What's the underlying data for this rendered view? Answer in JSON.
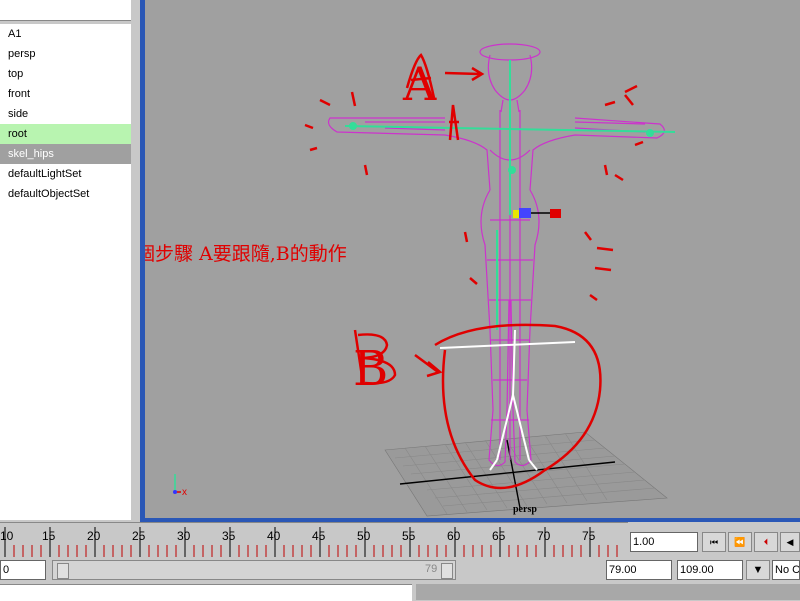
{
  "outliner": {
    "items": [
      {
        "label": "A1",
        "state": "normal"
      },
      {
        "label": "persp",
        "state": "normal"
      },
      {
        "label": "top",
        "state": "normal"
      },
      {
        "label": "front",
        "state": "normal"
      },
      {
        "label": "side",
        "state": "normal"
      },
      {
        "label": "root",
        "state": "selected"
      },
      {
        "label": "skel_hips",
        "state": "dimmed"
      },
      {
        "label": "defaultLightSet",
        "state": "normal"
      },
      {
        "label": "defaultObjectSet",
        "state": "normal"
      }
    ]
  },
  "viewport": {
    "camera_label": "persp",
    "axis_x_label": "x",
    "annotation_a": "A",
    "annotation_b": "B",
    "annotation_note": "下一個步驟 A要跟隨,B的動作",
    "colors": {
      "background": "#a0a0a0",
      "frame": "#2a57b6",
      "mesh": "#cc33cc",
      "joints": "#33dd99",
      "annotation": "#e00000",
      "skeleton_b": "#ffffff"
    }
  },
  "timeline": {
    "ticks": [
      "10",
      "15",
      "20",
      "25",
      "30",
      "35",
      "40",
      "45",
      "50",
      "55",
      "60",
      "65",
      "70",
      "75"
    ],
    "current_frame": "1.00"
  },
  "range": {
    "start": "0",
    "end_label": "79",
    "anim_end": "79.00",
    "playback_end": "109.00",
    "character_set": "No Ch"
  }
}
